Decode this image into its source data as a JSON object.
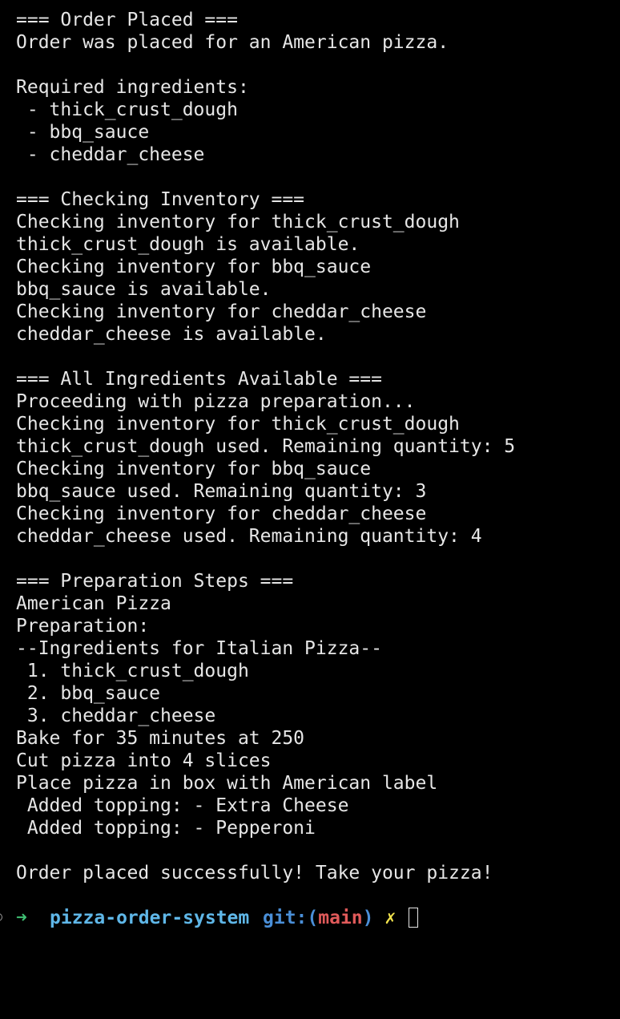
{
  "terminal": {
    "lines": [
      "=== Order Placed ===",
      "Order was placed for an American pizza.",
      "",
      "Required ingredients:",
      " - thick_crust_dough",
      " - bbq_sauce",
      " - cheddar_cheese",
      "",
      "=== Checking Inventory ===",
      "Checking inventory for thick_crust_dough",
      "thick_crust_dough is available.",
      "Checking inventory for bbq_sauce",
      "bbq_sauce is available.",
      "Checking inventory for cheddar_cheese",
      "cheddar_cheese is available.",
      "",
      "=== All Ingredients Available ===",
      "Proceeding with pizza preparation...",
      "Checking inventory for thick_crust_dough",
      "thick_crust_dough used. Remaining quantity: 5",
      "Checking inventory for bbq_sauce",
      "bbq_sauce used. Remaining quantity: 3",
      "Checking inventory for cheddar_cheese",
      "cheddar_cheese used. Remaining quantity: 4",
      "",
      "=== Preparation Steps ===",
      "American Pizza",
      "Preparation:",
      "--Ingredients for Italian Pizza--",
      " 1. thick_crust_dough",
      " 2. bbq_sauce",
      " 3. cheddar_cheese",
      "Bake for 35 minutes at 250",
      "Cut pizza into 4 slices",
      "Place pizza in box with American label",
      " Added topping: - Extra Cheese",
      " Added topping: - Pepperoni",
      "",
      "Order placed successfully! Take your pizza!"
    ]
  },
  "prompt": {
    "arrow": "➜",
    "directory": "pizza-order-system",
    "git_label": "git:(",
    "branch": "main",
    "git_close": ")",
    "dirty_mark": "✗"
  },
  "colors": {
    "background": "#000000",
    "text": "#e6e6e6",
    "arrow": "#3fbf73",
    "directory": "#5fb7e8",
    "git": "#4a8fd8",
    "branch": "#e05a5a",
    "dirty": "#f2e34d"
  }
}
